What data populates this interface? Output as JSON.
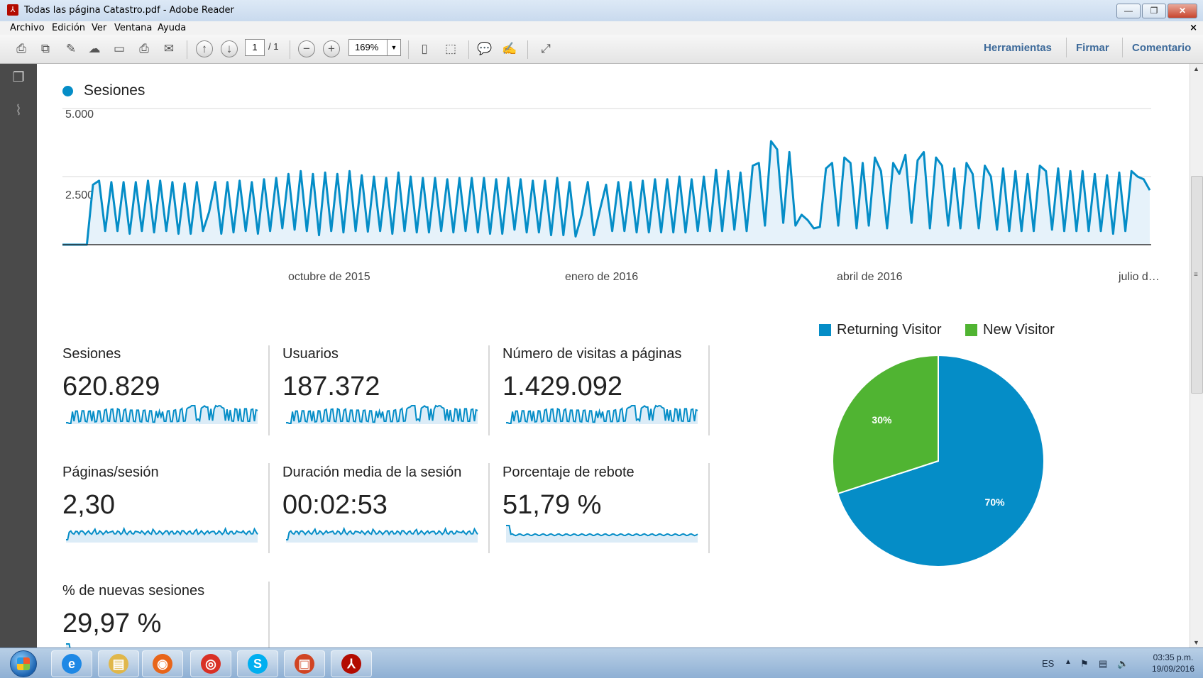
{
  "window": {
    "title": "Todas las página Catastro.pdf - Adobe Reader",
    "controls": [
      "—",
      "❐",
      "✕"
    ]
  },
  "menu": {
    "items": [
      "Archivo",
      "Edición",
      "Ver",
      "Ventana",
      "Ayuda"
    ],
    "close": "×"
  },
  "toolbar": {
    "page_current": "1",
    "page_total": "/ 1",
    "zoom": "169%",
    "links": [
      "Herramientas",
      "Firmar",
      "Comentario"
    ]
  },
  "chart_data": [
    {
      "type": "line",
      "series": [
        {
          "name": "Sesiones",
          "color": "#058dc7",
          "values": [
            0,
            0,
            0,
            0,
            0,
            2200,
            2350,
            500,
            2300,
            500,
            2300,
            400,
            2300,
            500,
            2350,
            450,
            2350,
            500,
            2300,
            400,
            2250,
            400,
            2300,
            500,
            1200,
            2300,
            400,
            2300,
            450,
            2350,
            500,
            2300,
            400,
            2400,
            500,
            2450,
            600,
            2600,
            550,
            2700,
            500,
            2600,
            350,
            2650,
            500,
            2600,
            450,
            2700,
            500,
            2550,
            480,
            2500,
            500,
            2450,
            400,
            2650,
            500,
            2500,
            450,
            2450,
            450,
            2450,
            500,
            2400,
            450,
            2450,
            500,
            2450,
            450,
            2450,
            400,
            2400,
            400,
            2450,
            550,
            2400,
            450,
            2350,
            450,
            2350,
            350,
            2450,
            350,
            2300,
            300,
            1100,
            2300,
            350,
            1300,
            2200,
            500,
            2300,
            500,
            2300,
            450,
            2350,
            450,
            2400,
            450,
            2400,
            450,
            2500,
            450,
            2400,
            500,
            2500,
            500,
            2750,
            500,
            2700,
            550,
            2650,
            500,
            2900,
            3000,
            700,
            3800,
            3500,
            800,
            3400,
            700,
            1100,
            900,
            600,
            650,
            2800,
            3000,
            700,
            3200,
            3000,
            600,
            3000,
            700,
            3200,
            2700,
            600,
            3000,
            2600,
            3300,
            800,
            3100,
            3400,
            600,
            3200,
            2900,
            700,
            2800,
            600,
            3000,
            2600,
            600,
            2900,
            2500,
            550,
            2800,
            500,
            2700,
            500,
            2600,
            500,
            2900,
            2700,
            550,
            2800,
            500,
            2700,
            500,
            2700,
            500,
            2600,
            500,
            2550,
            400,
            2650,
            500,
            2700,
            2500,
            2400,
            2000
          ]
        }
      ],
      "ylim": [
        0,
        5000
      ],
      "yticks": [
        "5.000",
        "2.500"
      ],
      "xticks": [
        "octubre de 2015",
        "enero de 2016",
        "abril de 2016",
        "julio d…"
      ],
      "grid": true
    },
    {
      "type": "pie",
      "series": [
        {
          "name": "Returning Visitor",
          "value": 70,
          "label": "70%",
          "color": "#058dc7"
        },
        {
          "name": "New Visitor",
          "value": 30,
          "label": "30%",
          "color": "#50b432"
        }
      ],
      "legend": "top"
    }
  ],
  "metrics": [
    {
      "label": "Sesiones",
      "value": "620.829",
      "spark": "sessions"
    },
    {
      "label": "Usuarios",
      "value": "187.372",
      "spark": "sessions"
    },
    {
      "label": "Número de visitas a páginas",
      "value": "1.429.092",
      "spark": "sessions"
    },
    {
      "label": "Páginas/sesión",
      "value": "2,30",
      "spark": "flat"
    },
    {
      "label": "Duración media de la sesión",
      "value": "00:02:53",
      "spark": "flat"
    },
    {
      "label": "Porcentaje de rebote",
      "value": "51,79 %",
      "spark": "bounce"
    },
    {
      "label": "% de nuevas sesiones",
      "value": "29,97 %",
      "spark": "bounce"
    }
  ],
  "taskbar": {
    "apps": [
      {
        "name": "internet-explorer",
        "glyph": "e",
        "color": "#1e88e5"
      },
      {
        "name": "file-explorer",
        "glyph": "▤",
        "color": "#e0b74a"
      },
      {
        "name": "firefox",
        "glyph": "◉",
        "color": "#e8651a"
      },
      {
        "name": "chrome",
        "glyph": "◎",
        "color": "#d93025"
      },
      {
        "name": "skype",
        "glyph": "S",
        "color": "#00aff0"
      },
      {
        "name": "powerpoint",
        "glyph": "▣",
        "color": "#d04423"
      },
      {
        "name": "adobe-reader",
        "glyph": "⅄",
        "color": "#b30b00"
      }
    ],
    "lang": "ES",
    "time": "03:35 p.m.",
    "date": "19/09/2016"
  }
}
